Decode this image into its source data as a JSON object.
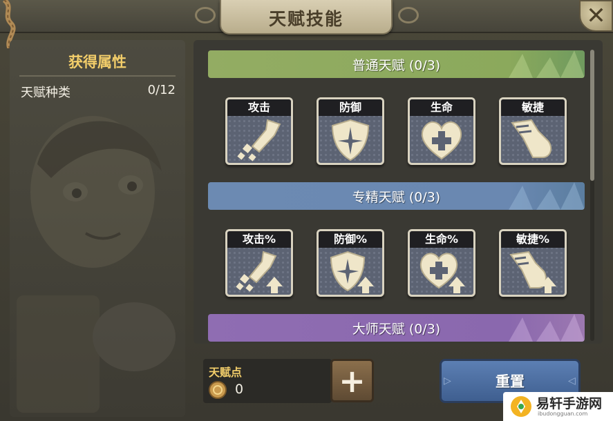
{
  "window": {
    "title": "天赋技能",
    "close_icon": "close-icon"
  },
  "left_panel": {
    "heading": "获得属性",
    "stat_label": "天赋种类",
    "stat_value": "0/12"
  },
  "categories": [
    {
      "label": "普通天赋 (0/3)",
      "color": "#8ba95c"
    },
    {
      "label": "专精天赋 (0/3)",
      "color": "#6a88b1"
    },
    {
      "label": "大师天赋 (0/3)",
      "color": "#8a68ae"
    }
  ],
  "skills_basic": [
    {
      "label": "攻击",
      "icon": "sword-icon"
    },
    {
      "label": "防御",
      "icon": "shield-icon"
    },
    {
      "label": "生命",
      "icon": "heart-plus-icon"
    },
    {
      "label": "敏捷",
      "icon": "boot-icon"
    }
  ],
  "skills_percent": [
    {
      "label": "攻击%",
      "icon": "sword-up-icon"
    },
    {
      "label": "防御%",
      "icon": "shield-up-icon"
    },
    {
      "label": "生命%",
      "icon": "heart-plus-up-icon"
    },
    {
      "label": "敏捷%",
      "icon": "boot-up-icon"
    }
  ],
  "bottom": {
    "points_label": "天赋点",
    "points_value": "0",
    "plus_label": "+",
    "reset_label": "重置"
  },
  "watermark": {
    "name": "易轩手游网",
    "url": "ibudongguan.com"
  }
}
